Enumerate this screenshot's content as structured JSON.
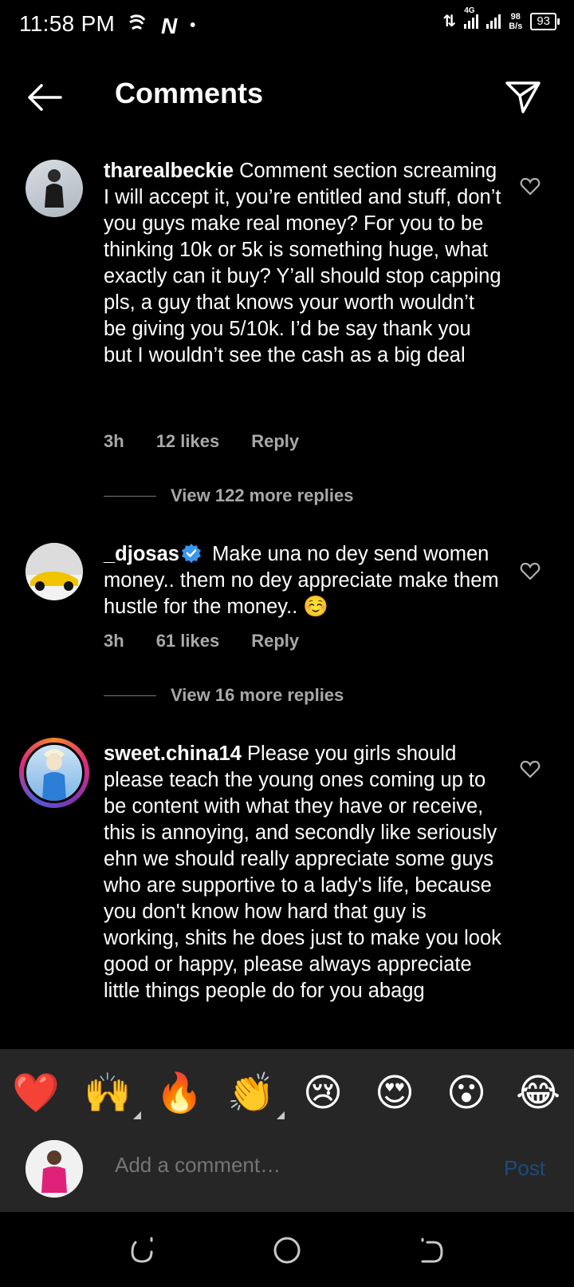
{
  "status_bar": {
    "time": "11:58 PM",
    "signal_label": "4G",
    "net_rate_top": "98",
    "net_rate_bottom": "B/s",
    "battery": "93"
  },
  "header": {
    "title": "Comments"
  },
  "comments": [
    {
      "username": "tharealbeckie",
      "verified": false,
      "text": "Comment section screaming I will accept it, you’re entitled and stuff, don’t you guys make real money? For you to be thinking 10k or 5k is something huge, what exactly can it buy? Y’all should stop capping pls, a guy that knows your worth wouldn’t be giving you 5/10k. I’d be say thank you but I wouldn’t see the cash as a big deal",
      "time": "3h",
      "likes": "12 likes",
      "reply": "Reply",
      "view_replies": "View 122 more replies"
    },
    {
      "username": "_djosas",
      "verified": true,
      "text": "Make una no dey send women money.. them no dey appreciate make them hustle for the money.. ☺️",
      "time": "3h",
      "likes": "61 likes",
      "reply": "Reply",
      "view_replies": "View 16 more replies"
    },
    {
      "username": "sweet.china14",
      "verified": false,
      "text": "Please you girls should please teach the young ones coming up to be content with what they have or receive, this is annoying, and secondly like seriously ehn we should really appreciate some guys who are supportive to a lady's life, because you don't know how hard that guy is working, shits he does just to make you look good or happy, please always appreciate little things people do for you abagg"
    }
  ],
  "emoji_bar": [
    "❤️",
    "🙌",
    "🔥",
    "👏",
    "😢",
    "😍",
    "😮",
    "😂"
  ],
  "composer": {
    "placeholder": "Add a comment…",
    "post_label": "Post"
  },
  "colors": {
    "background": "#000000",
    "composer_bg": "#262626",
    "meta_text": "#a8a8a8",
    "post_disabled": "#1d4b7d",
    "verified_blue": "#3897f0"
  }
}
